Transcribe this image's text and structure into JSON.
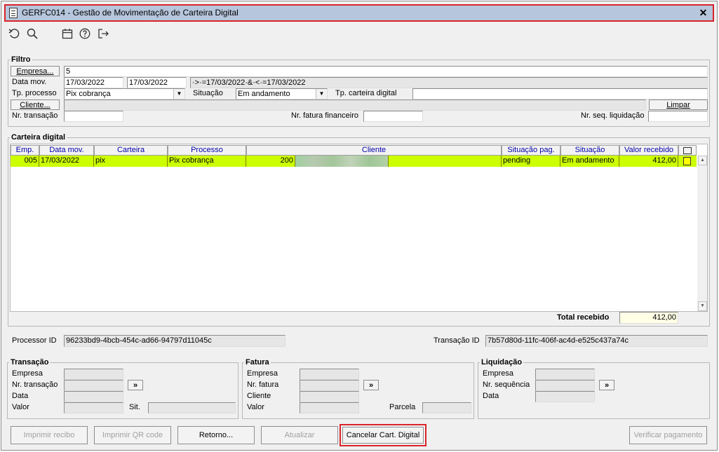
{
  "window": {
    "title": "GERFC014 - Gestão de Movimentação de Carteira Digital",
    "close_glyph": "✕"
  },
  "toolbar": {
    "icons": [
      "undo-icon",
      "search-icon",
      "calendar-icon",
      "help-icon",
      "exit-icon"
    ]
  },
  "filtro": {
    "legend": "Filtro",
    "empresa_button": "Empresa...",
    "empresa_value": "5",
    "data_mov_label": "Data mov.",
    "data_mov_from": "17/03/2022",
    "data_mov_to": "17/03/2022",
    "data_mov_expr": "·>·=17/03/2022·&·<·=17/03/2022",
    "tp_processo_label": "Tp. processo",
    "tp_processo_value": "Pix cobrança",
    "situacao_label": "Situação",
    "situacao_value": "Em andamento",
    "tp_carteira_label": "Tp. carteira digital",
    "tp_carteira_value": "",
    "cliente_button": "Cliente...",
    "limpar_button": "Limpar",
    "nr_transacao_label": "Nr. transação",
    "nr_fatura_label": "Nr. fatura financeiro",
    "nr_seq_liq_label": "Nr. seq. liquidação"
  },
  "carteira": {
    "legend": "Carteira digital",
    "columns": [
      "Emp.",
      "Data mov.",
      "Carteira",
      "Processo",
      "Cliente",
      "Situação pag.",
      "Situação",
      "Valor recebido"
    ],
    "rows": [
      {
        "emp": "005",
        "data_mov": "17/03/2022",
        "carteira": "pix",
        "processo": "Pix cobrança",
        "cliente_cod": "200",
        "cliente_nome": "",
        "situacao_pag": "pending",
        "situacao": "Em andamento",
        "valor": "412,00"
      }
    ],
    "total_label": "Total recebido",
    "total_value": "412,00"
  },
  "ids": {
    "processor_label": "Processor ID",
    "processor_value": "96233bd9-4bcb-454c-ad66-94797d11045c",
    "transacao_label": "Transação ID",
    "transacao_value": "7b57d80d-11fc-406f-ac4d-e525c437a74c"
  },
  "transacao": {
    "legend": "Transação",
    "empresa": "Empresa",
    "nr_transacao": "Nr. transação",
    "data": "Data",
    "valor": "Valor",
    "sit": "Sit.",
    "goto": "»"
  },
  "fatura": {
    "legend": "Fatura",
    "empresa": "Empresa",
    "nr_fatura": "Nr. fatura",
    "cliente": "Cliente",
    "valor": "Valor",
    "parcela": "Parcela",
    "goto": "»"
  },
  "liquidacao": {
    "legend": "Liquidação",
    "empresa": "Empresa",
    "nr_sequencia": "Nr. sequência",
    "data": "Data",
    "goto": "»"
  },
  "buttons": {
    "imprimir_recibo": "Imprimir recibo",
    "imprimir_qr": "Imprimir QR code",
    "retorno": "Retorno...",
    "atualizar": "Atualizar",
    "cancelar": "Cancelar Cart. Digital",
    "verificar": "Verificar pagamento"
  },
  "colors": {
    "highlight_row": "#ccff00",
    "title_bar": "#b6c6dc",
    "focus_outline": "#d9242a"
  }
}
